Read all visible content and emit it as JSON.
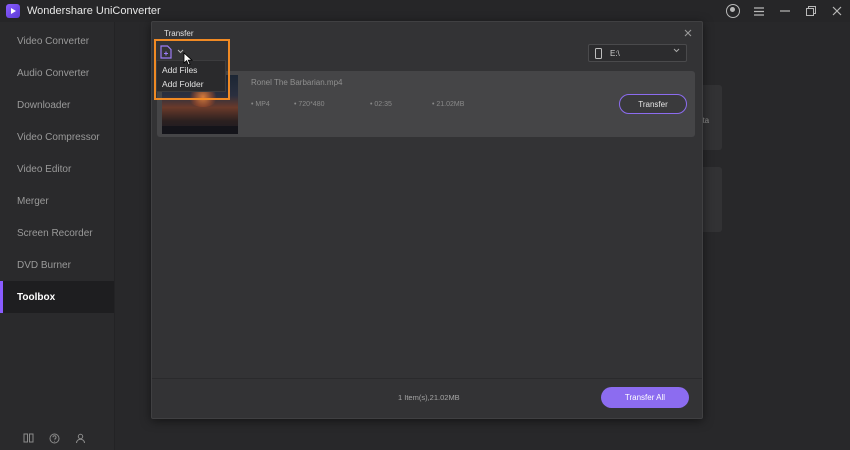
{
  "app": {
    "title": "Wondershare UniConverter"
  },
  "sidebar": {
    "items": [
      {
        "label": "Video Converter"
      },
      {
        "label": "Audio Converter"
      },
      {
        "label": "Downloader"
      },
      {
        "label": "Video Compressor"
      },
      {
        "label": "Video Editor"
      },
      {
        "label": "Merger"
      },
      {
        "label": "Screen Recorder"
      },
      {
        "label": "DVD Burner"
      },
      {
        "label": "Toolbox",
        "active": true
      }
    ],
    "bottom_icons": [
      "book-icon",
      "help-icon",
      "account-icon"
    ]
  },
  "background": {
    "card_text": "ata"
  },
  "dialog": {
    "title": "Transfer",
    "destination": "E:\\",
    "menu": {
      "items": [
        "Add Files",
        "Add Folder"
      ]
    },
    "file": {
      "name": "Ronel The Barbarian.mp4",
      "format": "• MP4",
      "resolution": "• 720*480",
      "duration": "• 02:35",
      "size": "• 21.02MB",
      "action": "Transfer"
    },
    "footer": {
      "summary": "1 Item(s),21.02MB",
      "transfer_all": "Transfer All"
    }
  },
  "colors": {
    "accent": "#8c6cf0",
    "highlight": "#f08a24"
  }
}
